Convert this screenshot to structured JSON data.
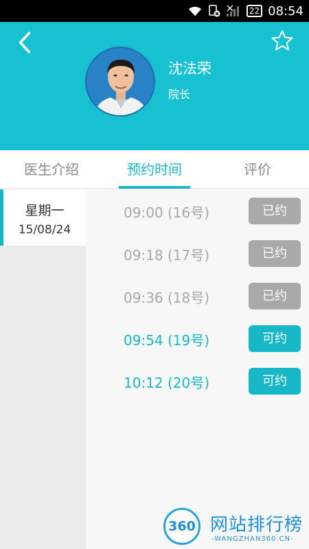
{
  "status_bar": {
    "battery": "22",
    "time": "08:54"
  },
  "header": {
    "back_icon": "chevron-left-icon",
    "favorite_icon": "star-outline-icon",
    "doctor_name": "沈法荣",
    "doctor_title": "院长"
  },
  "tabs": [
    {
      "label": "医生介绍",
      "active": false
    },
    {
      "label": "预约时间",
      "active": true
    },
    {
      "label": "评价",
      "active": false
    }
  ],
  "days": [
    {
      "name": "星期一",
      "date": "15/08/24",
      "selected": true
    }
  ],
  "slots": [
    {
      "time": "09:00  (16号)",
      "status": "已约",
      "available": false
    },
    {
      "time": "09:18  (17号)",
      "status": "已约",
      "available": false
    },
    {
      "time": "09:36  (18号)",
      "status": "已约",
      "available": false
    },
    {
      "time": "09:54  (19号)",
      "status": "可约",
      "available": true
    },
    {
      "time": "10:12  (20号)",
      "status": "可约",
      "available": true
    }
  ],
  "watermark": {
    "badge": "360",
    "text": "网站排行榜",
    "sub": "-WANGZHAN360.CN-"
  },
  "colors": {
    "accent": "#17c1d2",
    "booked": "#a9a9a9",
    "statusbar": "#000000"
  }
}
